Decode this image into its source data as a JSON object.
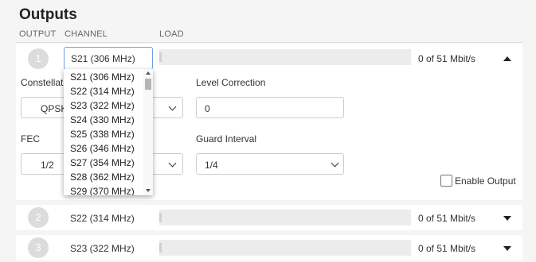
{
  "page": {
    "title": "Outputs"
  },
  "columns": {
    "output": "OUTPUT",
    "channel": "CHANNEL",
    "load": "LOAD"
  },
  "outputs": [
    {
      "number": "1",
      "channel": "S21 (306 MHz)",
      "rate": "0 of 51 Mbit/s",
      "expanded": true
    },
    {
      "number": "2",
      "channel": "S22 (314 MHz)",
      "rate": "0 of 51 Mbit/s",
      "expanded": false
    },
    {
      "number": "3",
      "channel": "S23 (322 MHz)",
      "rate": "0 of 51 Mbit/s",
      "expanded": false
    }
  ],
  "settings": {
    "constellation_label": "Constellation",
    "constellation_value": "QPSK",
    "level_correction_label": "Level Correction",
    "level_correction_value": "0",
    "fec_label": "FEC",
    "fec_value": "1/2",
    "guard_interval_label": "Guard Interval",
    "guard_interval_value": "1/4",
    "enable_output_label": "Enable Output",
    "enable_output_checked": false
  },
  "channel_dropdown": {
    "options": [
      "S21 (306 MHz)",
      "S22 (314 MHz)",
      "S23 (322 MHz)",
      "S24 (330 MHz)",
      "S25 (338 MHz)",
      "S26 (346 MHz)",
      "S27 (354 MHz)",
      "S28 (362 MHz)",
      "S29 (370 MHz)"
    ]
  },
  "colors": {
    "accent": "#6f9fe0",
    "badge": "#dcdcdc",
    "load_bar": "#ececec"
  },
  "icons": {
    "expand": "caret-up-icon",
    "collapse": "caret-down-icon",
    "select": "chevron-down-icon"
  }
}
